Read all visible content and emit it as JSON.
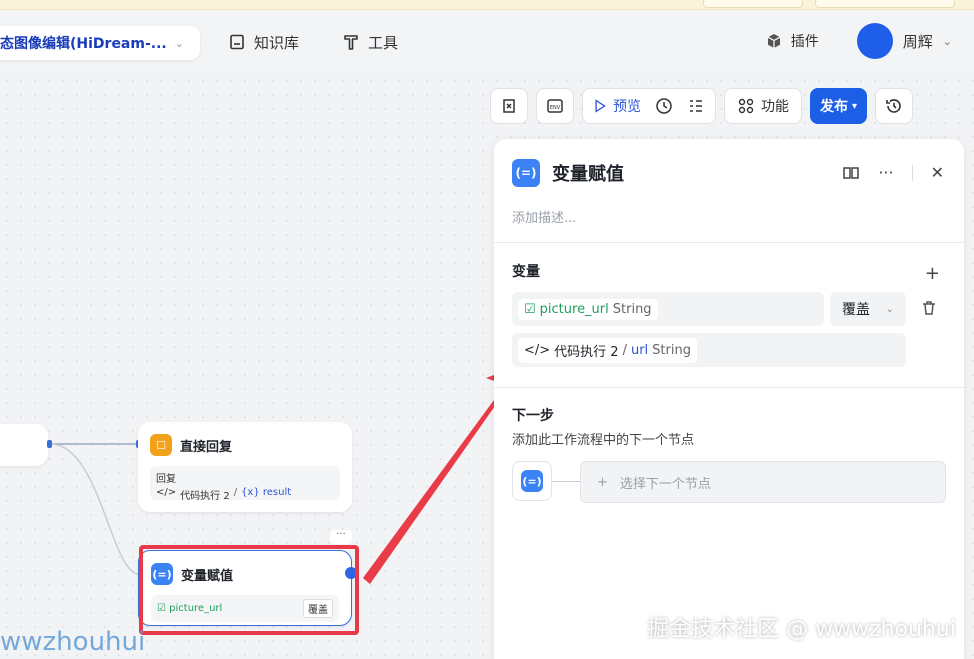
{
  "header": {
    "workflow_title": "态图像编辑(HiDream-...",
    "nav": [
      {
        "label": "知识库",
        "icon": "book-icon"
      },
      {
        "label": "工具",
        "icon": "tool-icon"
      }
    ],
    "plugin_label": "插件",
    "username": "周辉"
  },
  "toolbar": {
    "preview_label": "预览",
    "function_label": "功能",
    "publish_label": "发布"
  },
  "nodes": {
    "reply": {
      "title": "直接回复",
      "body_label": "回复",
      "body_source": "代码执行 2",
      "body_var": "{x} result"
    },
    "assign": {
      "title": "变量赋值",
      "var": "picture_url",
      "mode": "覆盖"
    }
  },
  "panel": {
    "title": "变量赋值",
    "description_placeholder": "添加描述...",
    "variables_label": "变量",
    "var_name": "picture_url",
    "var_type": "String",
    "mode": "覆盖",
    "source_node": "代码执行 2",
    "source_sep": "/",
    "source_var": "url",
    "source_type": "String",
    "next_label": "下一步",
    "next_desc": "添加此工作流程中的下一个节点",
    "next_placeholder": "选择下一个节点"
  },
  "watermarks": {
    "right": "掘金技术社区 @ wwwzhouhui",
    "left": "wwzhouhui"
  },
  "colors": {
    "accent": "#1d5ee6",
    "highlight_red": "#e8394a",
    "variable_green": "#1f9e5a"
  }
}
